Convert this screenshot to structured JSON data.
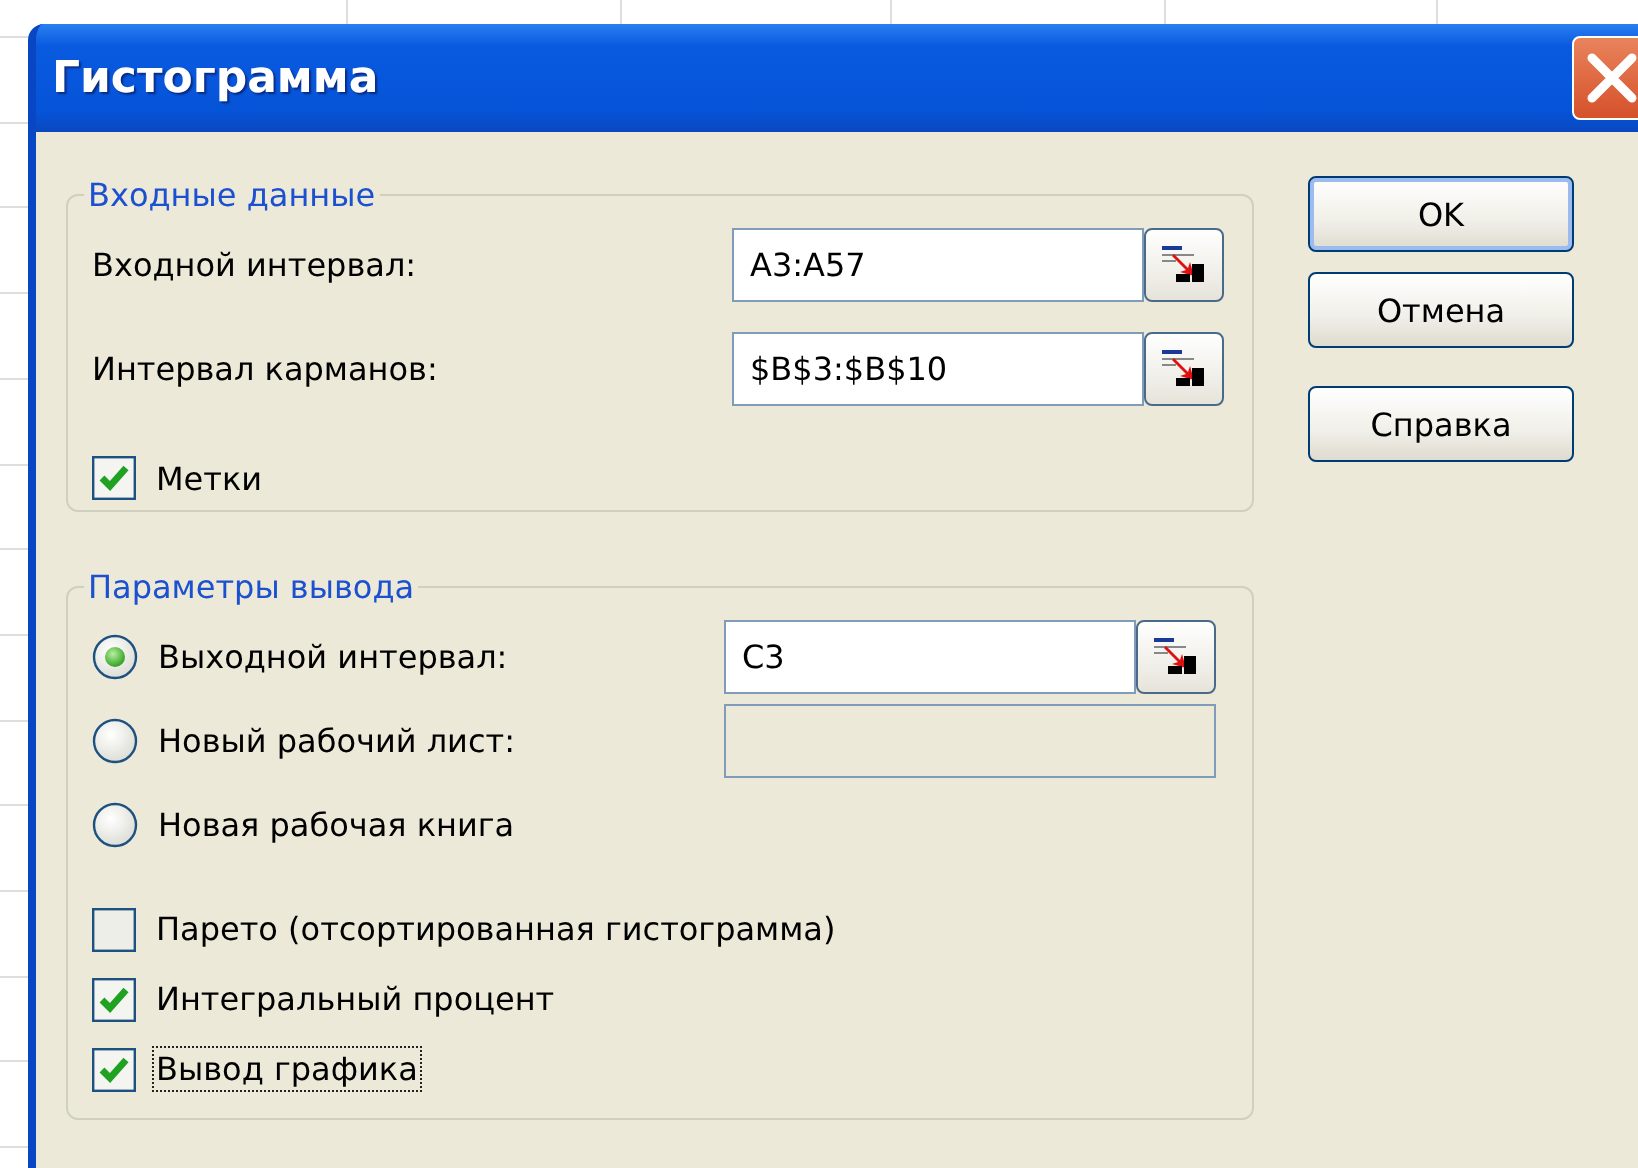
{
  "window": {
    "title": "Гистограмма"
  },
  "input_group": {
    "title": "Входные данные",
    "fields": [
      {
        "label": "Входной интервал:",
        "value": "A3:A57"
      },
      {
        "label": "Интервал карманов:",
        "value": "$B$3:$B$10"
      }
    ],
    "labels_checkbox": {
      "label": "Метки",
      "checked": true
    }
  },
  "output_group": {
    "title": "Параметры вывода",
    "options": [
      {
        "label": "Выходной интервал:",
        "selected": true,
        "field": {
          "value": "C3",
          "disabled": false
        }
      },
      {
        "label": "Новый рабочий лист:",
        "selected": false,
        "field": {
          "disabled": true
        }
      },
      {
        "label": "Новая рабочая книга",
        "selected": false
      }
    ],
    "checkboxes": [
      {
        "label": "Парето (отсортированная гистограмма)",
        "checked": false,
        "focused": false
      },
      {
        "label": "Интегральный процент",
        "checked": true,
        "focused": false
      },
      {
        "label": "Вывод графика",
        "checked": true,
        "focused": true
      }
    ]
  },
  "buttons": [
    {
      "label": "OK",
      "default": true
    },
    {
      "label": "Отмена",
      "default": false
    },
    {
      "label": "Справка",
      "default": false
    }
  ]
}
